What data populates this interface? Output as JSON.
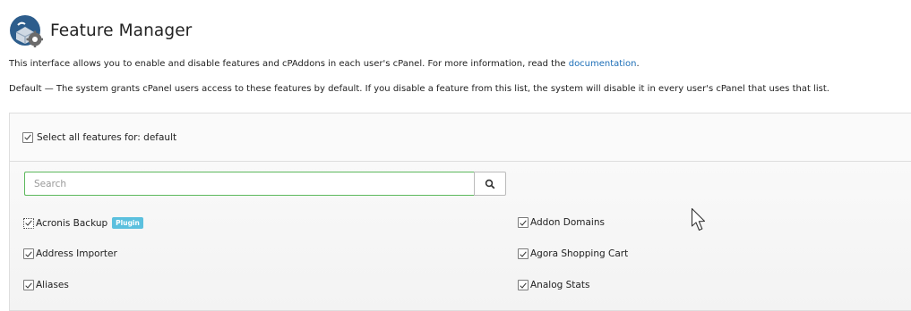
{
  "header": {
    "title": "Feature Manager",
    "logo_icon": "cpanel-feature-manager-icon"
  },
  "description": {
    "line1_text": "This interface allows you to enable and disable features and cPAddons in each user's cPanel. For more information, read the ",
    "line1_link": "documentation",
    "line1_end": ".",
    "line2": "Default — The system grants cPanel users access to these features by default. If you disable a feature from this list, the system will disable it in every user's cPanel that uses that list."
  },
  "select_all": {
    "label": "Select all features for: default",
    "checked": true
  },
  "search": {
    "placeholder": "Search",
    "value": "",
    "button_icon": "search-icon"
  },
  "features": [
    {
      "label": "Acronis Backup",
      "badge": "Plugin",
      "checked": true
    },
    {
      "label": "Addon Domains",
      "checked": true
    },
    {
      "label": "Address Importer",
      "checked": true
    },
    {
      "label": "Agora Shopping Cart",
      "checked": true
    },
    {
      "label": "Aliases",
      "checked": true
    },
    {
      "label": "Analog Stats",
      "checked": true
    }
  ],
  "colors": {
    "link": "#1d6fb8",
    "badge": "#5bc0de",
    "search_border": "#5cb85c"
  }
}
